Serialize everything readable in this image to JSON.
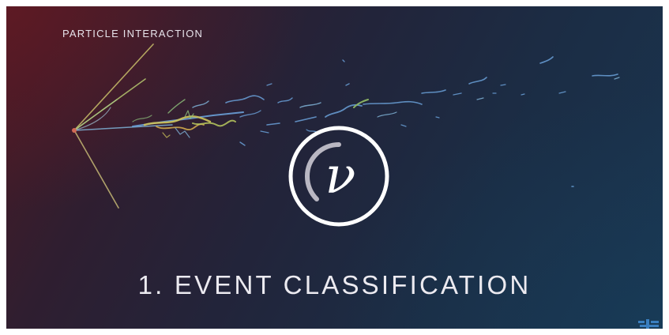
{
  "header": {
    "label": "PARTICLE INTERACTION"
  },
  "logo": {
    "glyph": "ν",
    "icon": "neutrino-logo-icon"
  },
  "main": {
    "title": "1. EVENT CLASSIFICATION"
  },
  "colors": {
    "background_left": "#4a1a24",
    "background_right": "#1a3550",
    "track_primary": "#6aa0d8",
    "track_secondary": "#c8c85a",
    "track_tertiary": "#8cc87a",
    "accent_corner": "#3a7fc0"
  },
  "icons": {
    "corner": "brand-mark-icon"
  }
}
